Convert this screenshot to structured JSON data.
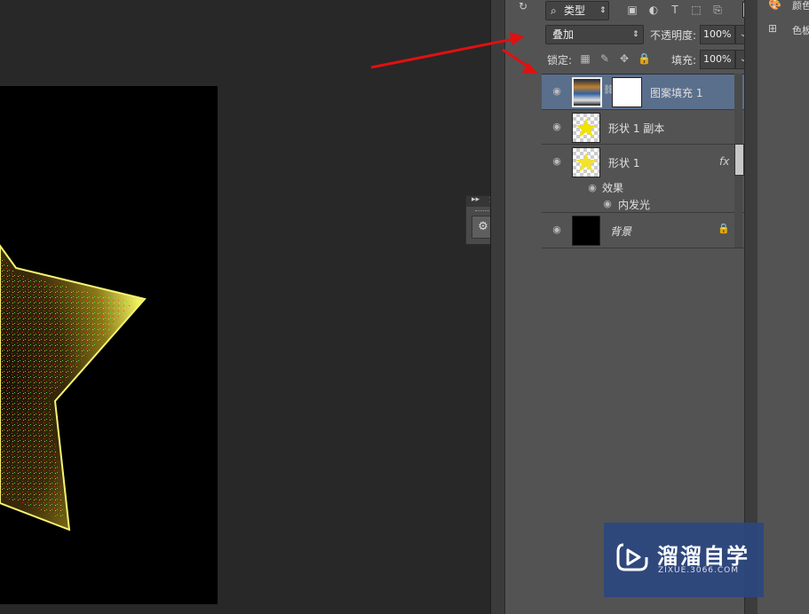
{
  "layers_panel": {
    "filter_type": "类型",
    "blend_mode": "叠加",
    "opacity_label": "不透明度:",
    "opacity_value": "100%",
    "lock_label": "锁定:",
    "fill_label": "填充:",
    "fill_value": "100%",
    "layers": [
      {
        "name": "图案填充 1",
        "selected": true
      },
      {
        "name": "形状 1 副本",
        "selected": false
      },
      {
        "name": "形状 1",
        "fx": "fx",
        "selected": false
      },
      {
        "name": "背景",
        "selected": false
      }
    ],
    "effects_label": "效果",
    "effect_item": "内发光"
  },
  "right_panel": {
    "item1": "颜色",
    "item2": "色板"
  },
  "watermark": {
    "title": "溜溜自学",
    "url": "ZIXUE.3066.COM"
  },
  "colors": {
    "arrow": "#e01010",
    "selected_layer": "#5a6f8c",
    "star_yellow": "#e8e84a",
    "watermark_bg": "#2c4880"
  }
}
